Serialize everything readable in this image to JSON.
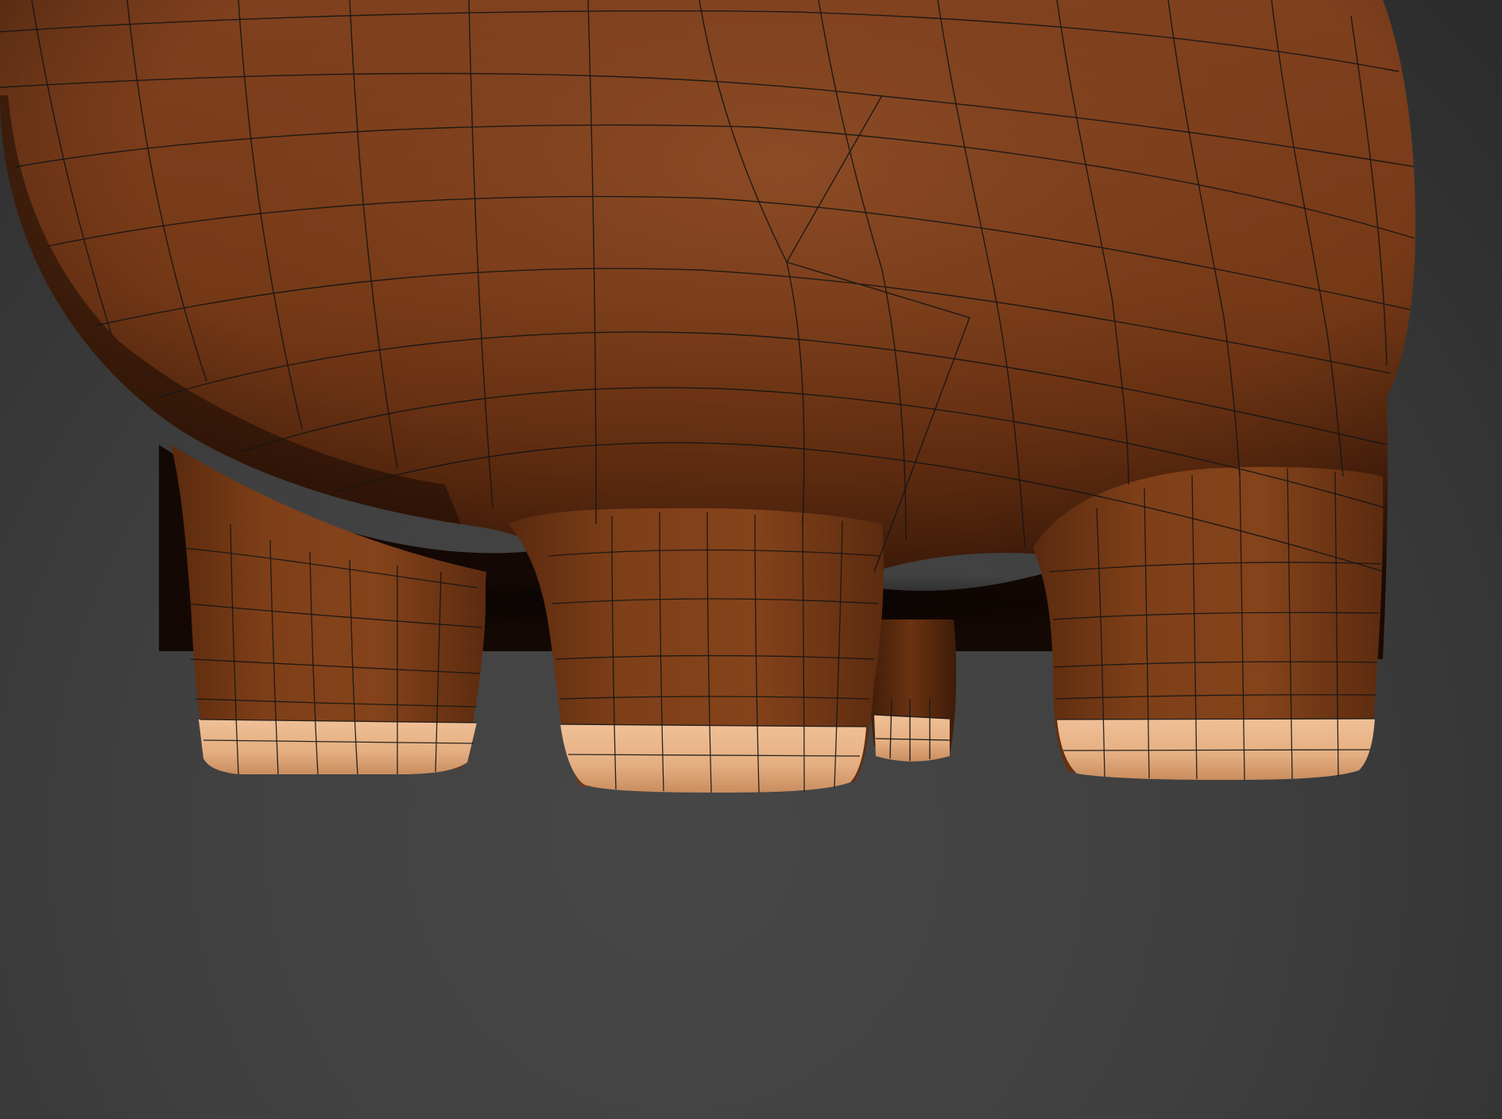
{
  "viewport": {
    "background_color": "#444444",
    "shading_mode": "smooth-shaded-with-wireframe",
    "model": {
      "subject": "cartoon-animal-body-lower-half",
      "body_color": "#7c3e18",
      "body_highlight_color": "#8d4a22",
      "hoof_color": "#e8b387",
      "wire_color": "#111111"
    }
  }
}
